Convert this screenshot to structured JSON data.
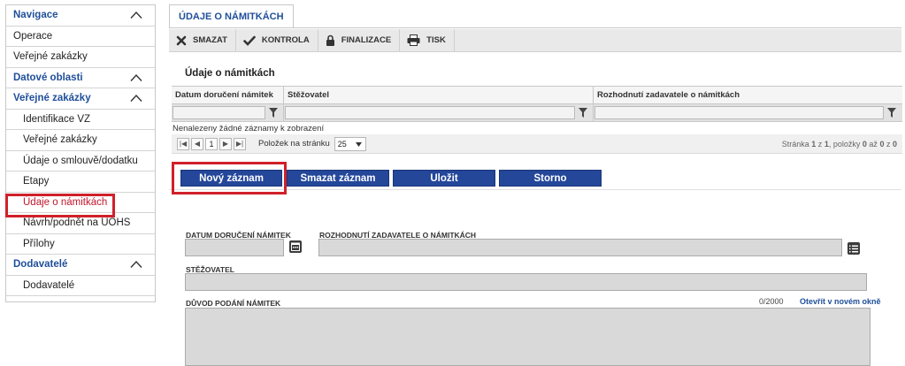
{
  "sidebar": {
    "sections": [
      {
        "type": "head",
        "label": "Navigace"
      },
      {
        "type": "plain",
        "label": "Operace"
      },
      {
        "type": "plain",
        "label": "Veřejné zakázky"
      },
      {
        "type": "head",
        "label": "Datové oblasti"
      },
      {
        "type": "head",
        "label": "Veřejné zakázky"
      },
      {
        "type": "sub",
        "label": "Identifikace VZ"
      },
      {
        "type": "sub",
        "label": "Veřejné zakázky"
      },
      {
        "type": "sub",
        "label": "Údaje o smlouvě/dodatku"
      },
      {
        "type": "sub",
        "label": "Etapy"
      },
      {
        "type": "sub",
        "label": "Údaje o námitkách",
        "active": true
      },
      {
        "type": "sub",
        "label": "Návrh/podnět na ÚOHS"
      },
      {
        "type": "sub",
        "label": "Přílohy"
      },
      {
        "type": "head",
        "label": "Dodavatelé"
      },
      {
        "type": "sub",
        "label": "Dodavatelé"
      }
    ]
  },
  "tab": {
    "label": "ÚDAJE O NÁMITKÁCH"
  },
  "toolbar": {
    "delete": "SMAZAT",
    "check": "KONTROLA",
    "finalize": "FINALIZACE",
    "print": "TISK"
  },
  "section": {
    "title": "Údaje o námitkách"
  },
  "grid": {
    "columns": [
      "Datum doručení námitek",
      "Stěžovatel",
      "Rozhodnutí zadavatele o námitkách"
    ],
    "empty_text": "Nenalezeny žádné záznamy k zobrazení",
    "pager": {
      "page": "1",
      "per_page_label": "Položek na stránku",
      "per_page": "25",
      "info_prefix": "Stránka",
      "page_no": "1",
      "info_of": "z",
      "page_total": "1",
      "info_items": ", položky",
      "item_from": "0",
      "info_to": "až",
      "item_to": "0",
      "info_z": "z",
      "item_total": "0"
    }
  },
  "actions": {
    "new": "Nový záznam",
    "delete": "Smazat záznam",
    "save": "Uložit",
    "cancel": "Storno"
  },
  "form": {
    "date_label": "DATUM DORUČENÍ NÁMITEK",
    "decision_label": "ROZHODNUTÍ ZADAVATELE O NÁMITKÁCH",
    "complainant_label": "STĚŽOVATEL",
    "reason_label": "DŮVOD PODÁNÍ NÁMITEK",
    "reason_counter": "0/2000",
    "open_link": "Otevřít v novém okně"
  },
  "colors": {
    "accent": "#24479a",
    "highlight": "#d0202a",
    "heading": "#1f4f9a"
  }
}
